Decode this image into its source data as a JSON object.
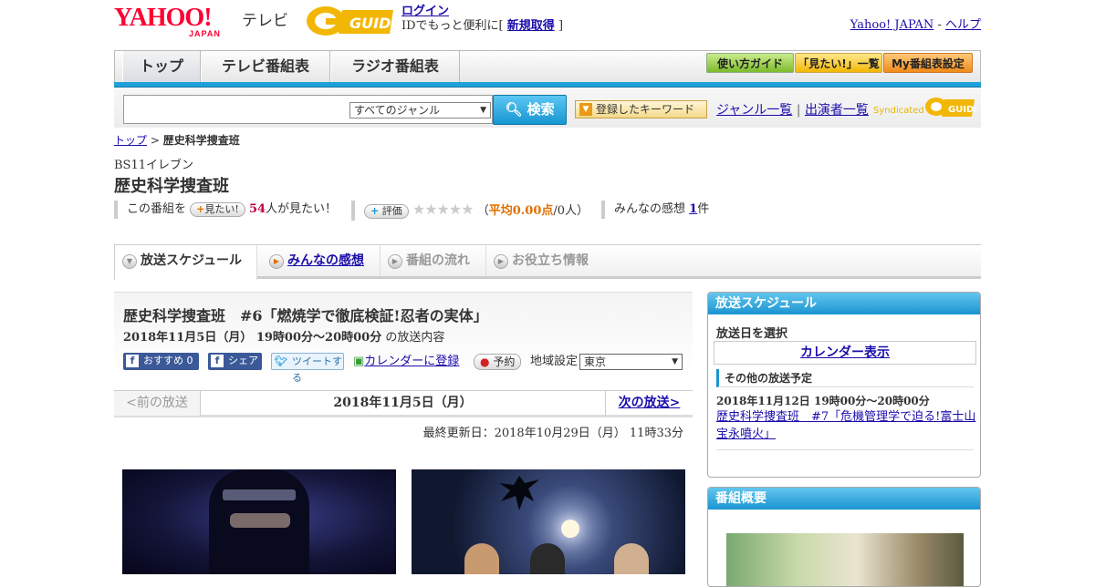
{
  "header": {
    "yahoo_logo": "YAHOO!",
    "yahoo_japan": "JAPAN",
    "tv_label": "テレビ",
    "gguide_logo": "G-GUIDE",
    "login_link": "ログイン",
    "login_prefix": "IDでもっと便利に[",
    "signup_link": "新規取得",
    "login_suffix": "]",
    "yahoo_japan_link": "Yahoo! JAPAN",
    "separator": "-",
    "help_link": "ヘルプ"
  },
  "nav": {
    "tabs": [
      "トップ",
      "テレビ番組表",
      "ラジオ番組表"
    ],
    "buttons": [
      "使い方ガイド",
      "「見たい!」一覧",
      "My番組表設定"
    ]
  },
  "search": {
    "placeholder": "",
    "genre_selected": "すべてのジャンル",
    "search_button": "検索",
    "keyword_button": "登録したキーワード",
    "genre_list_link": "ジャンル一覧",
    "performer_link": "出演者一覧",
    "syndicated": "Syndicated"
  },
  "breadcrumb": {
    "home": "トップ",
    "separator": ">",
    "current": "歴史科学捜査班"
  },
  "program": {
    "channel": "BS11イレブン",
    "title": "歴史科学捜査班",
    "want_prefix": "この番組を",
    "want_button": "見たい!",
    "want_count": "54",
    "want_suffix": "人が見たい！",
    "rate_button": "評価",
    "stars": "★★★★★",
    "avg_open": "（",
    "avg_label": "平均0.00点",
    "avg_people": "/0人）",
    "impressions_prefix": "みんなの感想",
    "impressions_count": "1",
    "impressions_suffix": "件"
  },
  "content_tabs": [
    {
      "label": "放送スケジュール",
      "state": "active"
    },
    {
      "label": "みんなの感想",
      "state": "link"
    },
    {
      "label": "番組の流れ",
      "state": "disabled"
    },
    {
      "label": "お役立ち情報",
      "state": "disabled"
    }
  ],
  "episode": {
    "title": "歴史科学捜査班　#6「燃焼学で徹底検証!忍者の実体」",
    "datetime": "2018年11月5日（月） 19時00分～20時00分",
    "datetime_suffix": "の放送内容",
    "recommend_button": "おすすめ 0",
    "share_button": "シェア",
    "tweet_button": "ツイートする",
    "calendar_link": "カレンダーに登録",
    "reserve_button": "予約",
    "region_label": "地域設定",
    "region_selected": "東京"
  },
  "pager": {
    "prev": "<前の放送",
    "current": "2018年11月5日（月）",
    "next": "次の放送>"
  },
  "updated": "最終更新日：2018年10月29日（月） 11時33分",
  "sidebar": {
    "schedule_header": "放送スケジュール",
    "select_date_label": "放送日を選択",
    "calendar_link": "カレンダー表示",
    "other_header": "その他の放送予定",
    "other_date": "2018年11月12日 19時00分～20時00分",
    "other_link": "歴史科学捜査班　#7「危機管理学で迫る!富士山宝永噴火」",
    "overview_header": "番組概要"
  },
  "colors": {
    "accent_blue": "#1a94d0",
    "link": "#1a0dab",
    "yahoo_red": "#ff0033"
  }
}
